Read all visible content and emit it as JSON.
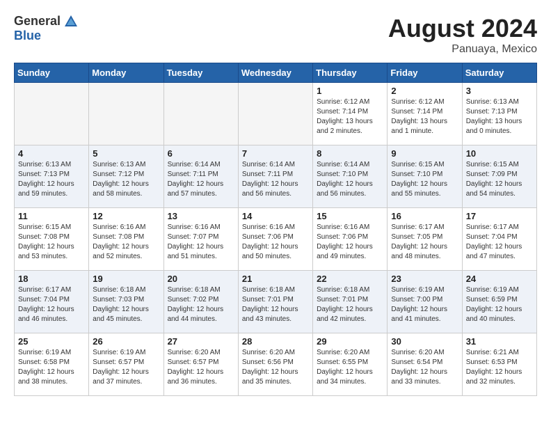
{
  "header": {
    "logo_general": "General",
    "logo_blue": "Blue",
    "month_title": "August 2024",
    "location": "Panuaya, Mexico"
  },
  "weekdays": [
    "Sunday",
    "Monday",
    "Tuesday",
    "Wednesday",
    "Thursday",
    "Friday",
    "Saturday"
  ],
  "weeks": [
    [
      {
        "day": "",
        "empty": true
      },
      {
        "day": "",
        "empty": true
      },
      {
        "day": "",
        "empty": true
      },
      {
        "day": "",
        "empty": true
      },
      {
        "day": "1",
        "sunrise": "6:12 AM",
        "sunset": "7:14 PM",
        "daylight": "13 hours and 2 minutes."
      },
      {
        "day": "2",
        "sunrise": "6:12 AM",
        "sunset": "7:14 PM",
        "daylight": "13 hours and 1 minute."
      },
      {
        "day": "3",
        "sunrise": "6:13 AM",
        "sunset": "7:13 PM",
        "daylight": "13 hours and 0 minutes."
      }
    ],
    [
      {
        "day": "4",
        "sunrise": "6:13 AM",
        "sunset": "7:13 PM",
        "daylight": "12 hours and 59 minutes."
      },
      {
        "day": "5",
        "sunrise": "6:13 AM",
        "sunset": "7:12 PM",
        "daylight": "12 hours and 58 minutes."
      },
      {
        "day": "6",
        "sunrise": "6:14 AM",
        "sunset": "7:11 PM",
        "daylight": "12 hours and 57 minutes."
      },
      {
        "day": "7",
        "sunrise": "6:14 AM",
        "sunset": "7:11 PM",
        "daylight": "12 hours and 56 minutes."
      },
      {
        "day": "8",
        "sunrise": "6:14 AM",
        "sunset": "7:10 PM",
        "daylight": "12 hours and 56 minutes."
      },
      {
        "day": "9",
        "sunrise": "6:15 AM",
        "sunset": "7:10 PM",
        "daylight": "12 hours and 55 minutes."
      },
      {
        "day": "10",
        "sunrise": "6:15 AM",
        "sunset": "7:09 PM",
        "daylight": "12 hours and 54 minutes."
      }
    ],
    [
      {
        "day": "11",
        "sunrise": "6:15 AM",
        "sunset": "7:08 PM",
        "daylight": "12 hours and 53 minutes."
      },
      {
        "day": "12",
        "sunrise": "6:16 AM",
        "sunset": "7:08 PM",
        "daylight": "12 hours and 52 minutes."
      },
      {
        "day": "13",
        "sunrise": "6:16 AM",
        "sunset": "7:07 PM",
        "daylight": "12 hours and 51 minutes."
      },
      {
        "day": "14",
        "sunrise": "6:16 AM",
        "sunset": "7:06 PM",
        "daylight": "12 hours and 50 minutes."
      },
      {
        "day": "15",
        "sunrise": "6:16 AM",
        "sunset": "7:06 PM",
        "daylight": "12 hours and 49 minutes."
      },
      {
        "day": "16",
        "sunrise": "6:17 AM",
        "sunset": "7:05 PM",
        "daylight": "12 hours and 48 minutes."
      },
      {
        "day": "17",
        "sunrise": "6:17 AM",
        "sunset": "7:04 PM",
        "daylight": "12 hours and 47 minutes."
      }
    ],
    [
      {
        "day": "18",
        "sunrise": "6:17 AM",
        "sunset": "7:04 PM",
        "daylight": "12 hours and 46 minutes."
      },
      {
        "day": "19",
        "sunrise": "6:18 AM",
        "sunset": "7:03 PM",
        "daylight": "12 hours and 45 minutes."
      },
      {
        "day": "20",
        "sunrise": "6:18 AM",
        "sunset": "7:02 PM",
        "daylight": "12 hours and 44 minutes."
      },
      {
        "day": "21",
        "sunrise": "6:18 AM",
        "sunset": "7:01 PM",
        "daylight": "12 hours and 43 minutes."
      },
      {
        "day": "22",
        "sunrise": "6:18 AM",
        "sunset": "7:01 PM",
        "daylight": "12 hours and 42 minutes."
      },
      {
        "day": "23",
        "sunrise": "6:19 AM",
        "sunset": "7:00 PM",
        "daylight": "12 hours and 41 minutes."
      },
      {
        "day": "24",
        "sunrise": "6:19 AM",
        "sunset": "6:59 PM",
        "daylight": "12 hours and 40 minutes."
      }
    ],
    [
      {
        "day": "25",
        "sunrise": "6:19 AM",
        "sunset": "6:58 PM",
        "daylight": "12 hours and 38 minutes."
      },
      {
        "day": "26",
        "sunrise": "6:19 AM",
        "sunset": "6:57 PM",
        "daylight": "12 hours and 37 minutes."
      },
      {
        "day": "27",
        "sunrise": "6:20 AM",
        "sunset": "6:57 PM",
        "daylight": "12 hours and 36 minutes."
      },
      {
        "day": "28",
        "sunrise": "6:20 AM",
        "sunset": "6:56 PM",
        "daylight": "12 hours and 35 minutes."
      },
      {
        "day": "29",
        "sunrise": "6:20 AM",
        "sunset": "6:55 PM",
        "daylight": "12 hours and 34 minutes."
      },
      {
        "day": "30",
        "sunrise": "6:20 AM",
        "sunset": "6:54 PM",
        "daylight": "12 hours and 33 minutes."
      },
      {
        "day": "31",
        "sunrise": "6:21 AM",
        "sunset": "6:53 PM",
        "daylight": "12 hours and 32 minutes."
      }
    ]
  ],
  "labels": {
    "sunrise": "Sunrise:",
    "sunset": "Sunset:",
    "daylight": "Daylight:"
  }
}
